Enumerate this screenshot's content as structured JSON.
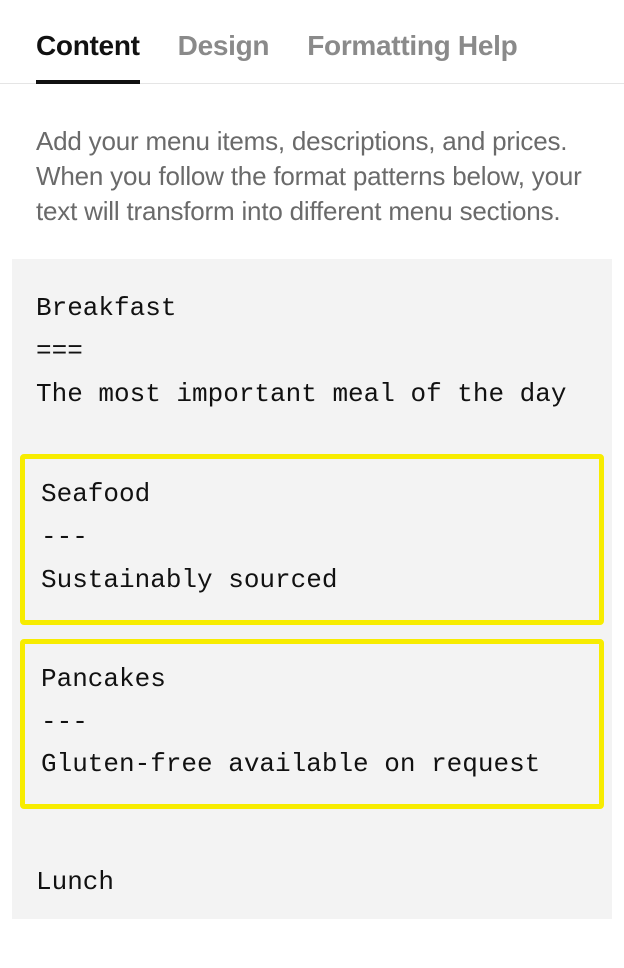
{
  "tabs": {
    "content": "Content",
    "design": "Design",
    "formatting_help": "Formatting Help"
  },
  "description": "Add your menu items, descriptions, and prices. When you follow the format patterns below, your text will transform into different menu sections.",
  "menu_blocks": {
    "breakfast": "Breakfast\n===\nThe most important meal of the day",
    "seafood": "Seafood\n---\nSustainably sourced",
    "pancakes": "Pancakes\n---\nGluten-free available on request",
    "lunch_partial": "Lunch"
  }
}
